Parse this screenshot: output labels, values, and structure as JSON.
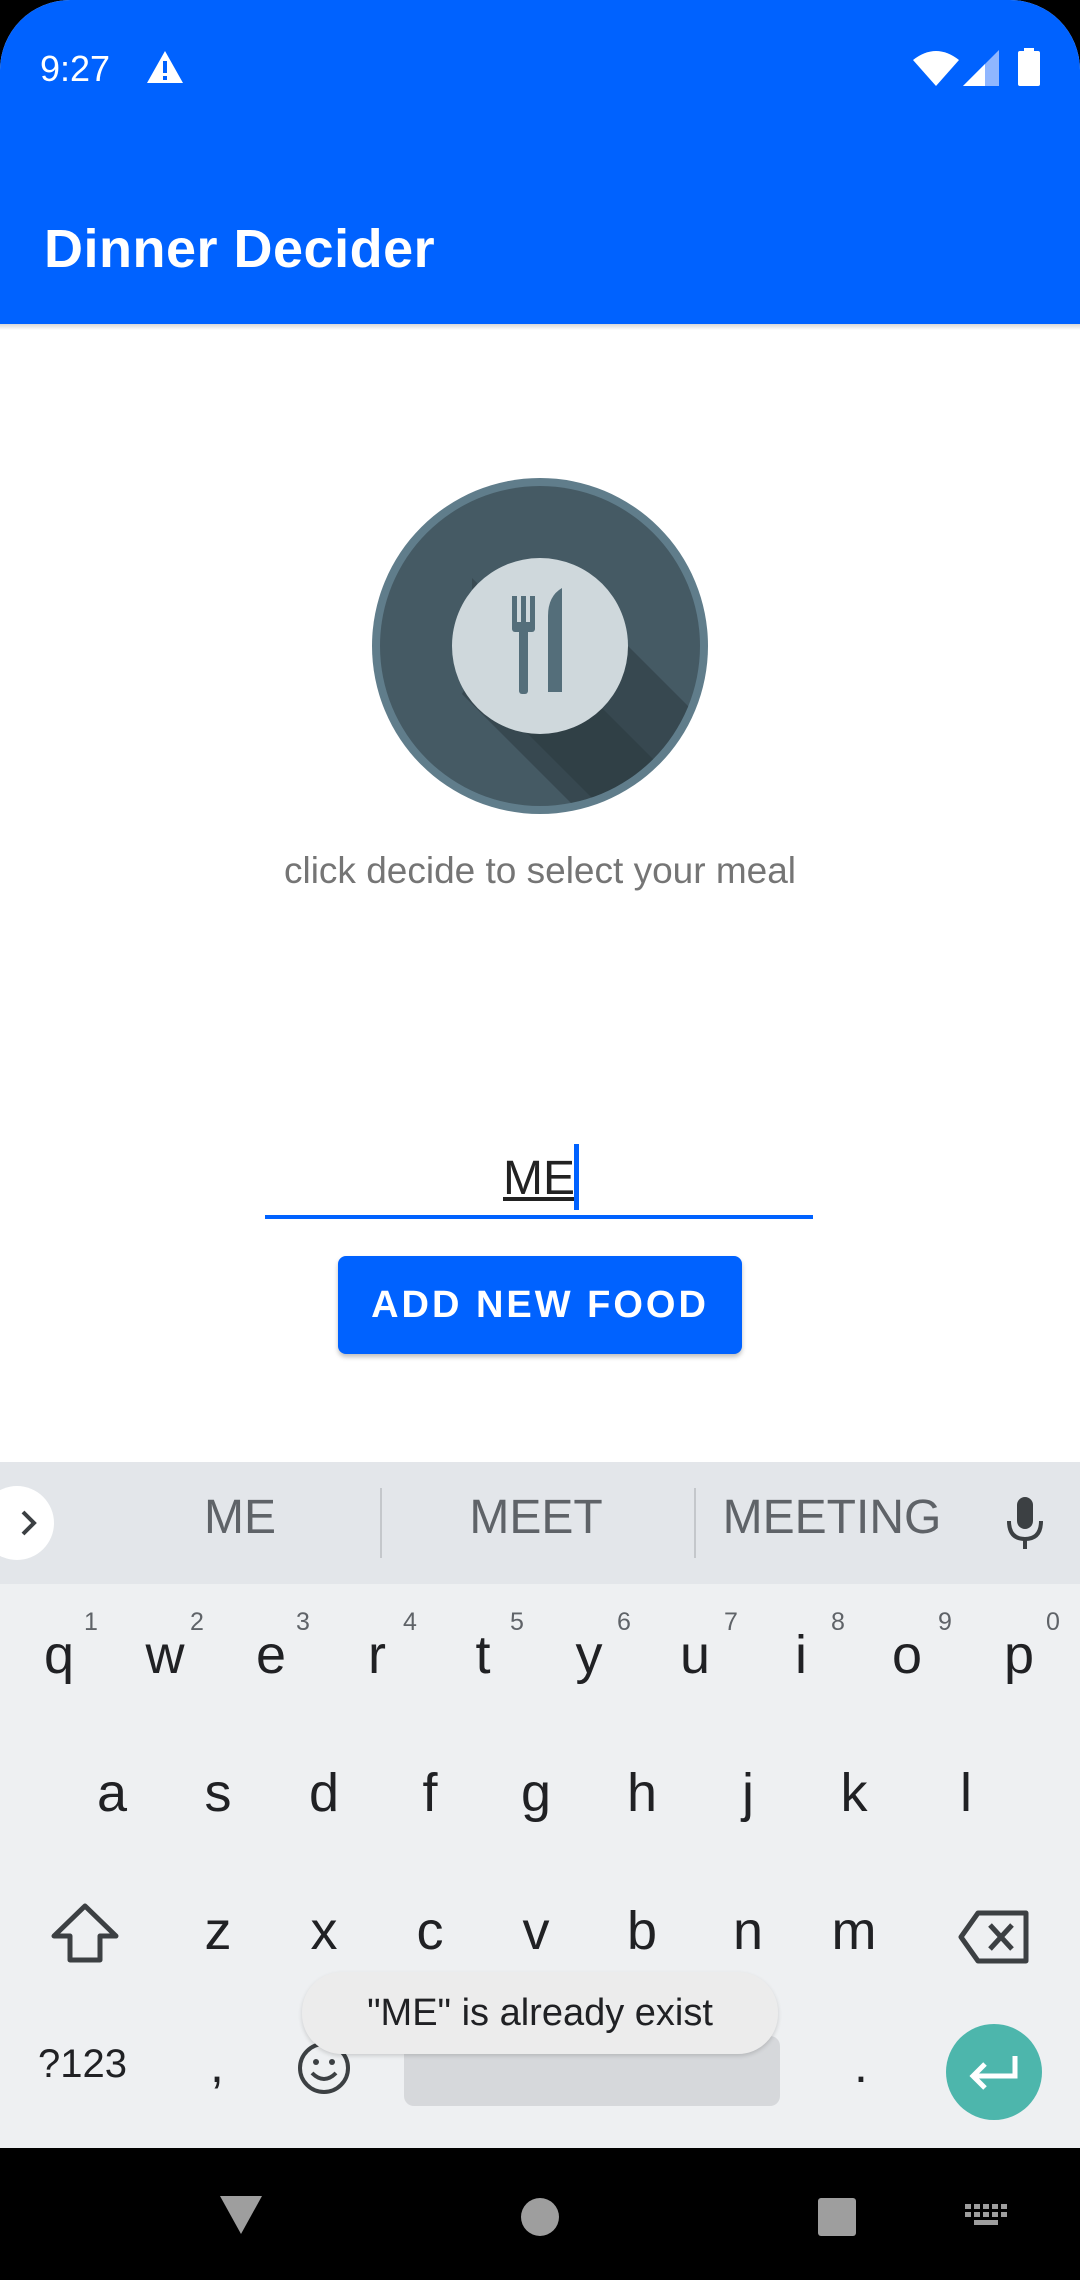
{
  "status_bar": {
    "time": "9:27",
    "icons": [
      "warning-icon",
      "wifi-icon",
      "signal-icon",
      "battery-icon"
    ]
  },
  "app_bar": {
    "title": "Dinner Decider",
    "color": "#0062ff"
  },
  "main": {
    "plate_icon": "plate-fork-knife-icon",
    "hint": "click decide to select your meal",
    "food_input": {
      "value": "ME"
    },
    "add_button_label": "ADD NEW FOOD"
  },
  "keyboard": {
    "suggestions": [
      "ME",
      "MEET",
      "MEETING"
    ],
    "row1": [
      "q",
      "w",
      "e",
      "r",
      "t",
      "y",
      "u",
      "i",
      "o",
      "p"
    ],
    "row1_hints": [
      "1",
      "2",
      "3",
      "4",
      "5",
      "6",
      "7",
      "8",
      "9",
      "0"
    ],
    "row2": [
      "a",
      "s",
      "d",
      "f",
      "g",
      "h",
      "j",
      "k",
      "l"
    ],
    "row3": [
      "z",
      "x",
      "c",
      "v",
      "b",
      "n",
      "m"
    ],
    "symbols_label": "?123",
    "comma": ",",
    "period": ".",
    "enter_color": "#4db6ac"
  },
  "toast": {
    "message": "\"ME\" is already exist"
  },
  "nav_bar": {
    "icons": [
      "back-icon",
      "home-icon",
      "recents-icon",
      "keyboard-switch-icon"
    ]
  }
}
